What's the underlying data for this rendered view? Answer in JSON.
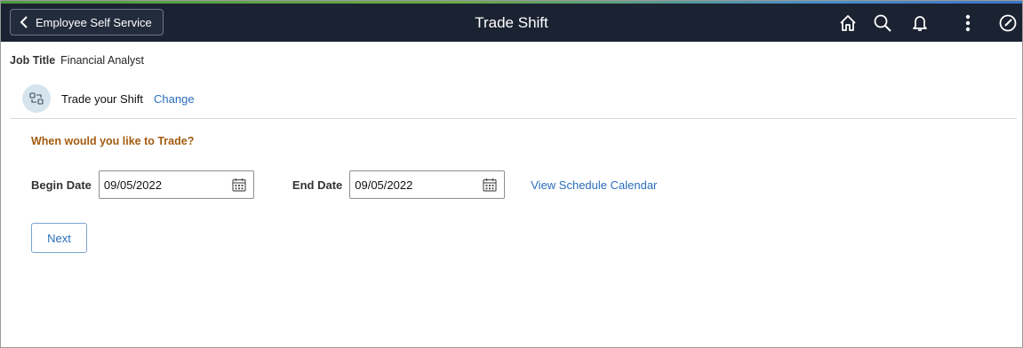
{
  "header": {
    "back_label": "Employee Self Service",
    "title": "Trade Shift",
    "icons": [
      "home-icon",
      "search-icon",
      "bell-icon",
      "more-vertical-icon",
      "navigator-compass-icon"
    ],
    "background_color": "#1b2332"
  },
  "job": {
    "label": "Job Title",
    "value": "Financial Analyst"
  },
  "trade": {
    "icon": "trade-shift-icon",
    "label": "Trade your Shift",
    "change_link": "Change"
  },
  "form": {
    "question": "When would you like to Trade?",
    "begin_date_label": "Begin Date",
    "begin_date_value": "09/05/2022",
    "end_date_label": "End Date",
    "end_date_value": "09/05/2022",
    "calendar_icon": "calendar-icon",
    "view_calendar_link": "View Schedule Calendar",
    "next_label": "Next"
  },
  "colors": {
    "accent_link": "#2a6ebb",
    "question_text": "#a35c10",
    "trade_icon_bg": "#d6e4ee"
  }
}
